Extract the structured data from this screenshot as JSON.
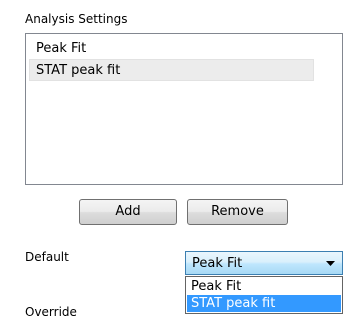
{
  "section": {
    "title": "Analysis Settings"
  },
  "settings_list": {
    "items": [
      {
        "label": "Peak Fit",
        "selected": false
      },
      {
        "label": "STAT peak fit",
        "selected": true
      }
    ]
  },
  "buttons": {
    "add_label": "Add",
    "remove_label": "Remove"
  },
  "default": {
    "label": "Default",
    "selected_value": "Peak Fit",
    "options": [
      {
        "label": "Peak Fit",
        "highlighted": false
      },
      {
        "label": "STAT peak fit",
        "highlighted": true
      }
    ]
  },
  "override": {
    "label": "Override"
  },
  "icons": {
    "dropdown_arrow": "chevron-down-icon"
  },
  "colors": {
    "highlight": "#3399ff",
    "selected_item": "#ececec",
    "combo_border": "#3c7fb1"
  }
}
